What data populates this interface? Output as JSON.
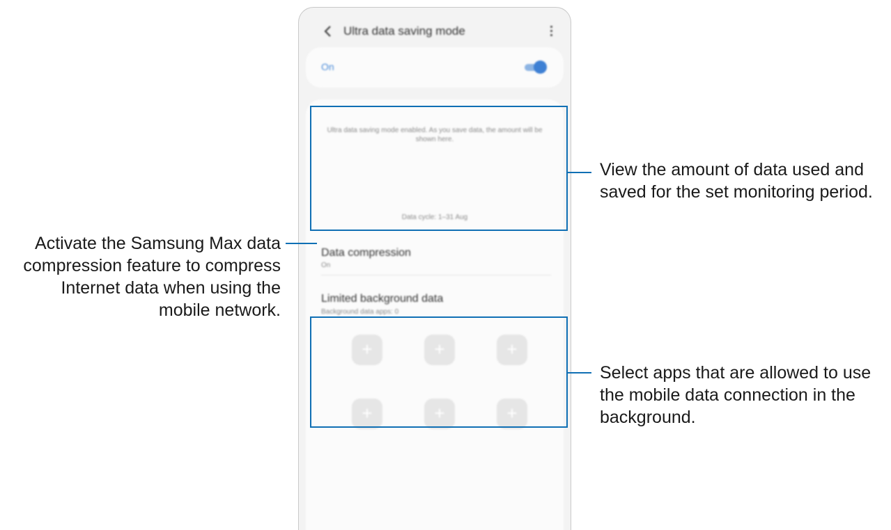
{
  "header": {
    "title": "Ultra data saving mode"
  },
  "master_switch": {
    "label": "On",
    "state": "on"
  },
  "usage_panel": {
    "message": "Ultra data saving mode enabled. As you save data, the amount will be shown here.",
    "cycle": "Data cycle: 1–31 Aug"
  },
  "settings": [
    {
      "title": "Data compression",
      "subtitle": "On"
    },
    {
      "title": "Limited background data",
      "subtitle": "Background data apps: 0"
    }
  ],
  "app_slots": [
    "+",
    "+",
    "+",
    "+",
    "+",
    "+"
  ],
  "callouts": {
    "usage": "View the amount of data used and saved for the set monitoring period.",
    "compression": "Activate the Samsung Max data compression feature to compress Internet data when using the mobile network.",
    "background": "Select apps that are allowed to use the mobile data connection in the background."
  },
  "colors": {
    "accent": "#3e80d4",
    "highlight": "#0f6fb4"
  }
}
